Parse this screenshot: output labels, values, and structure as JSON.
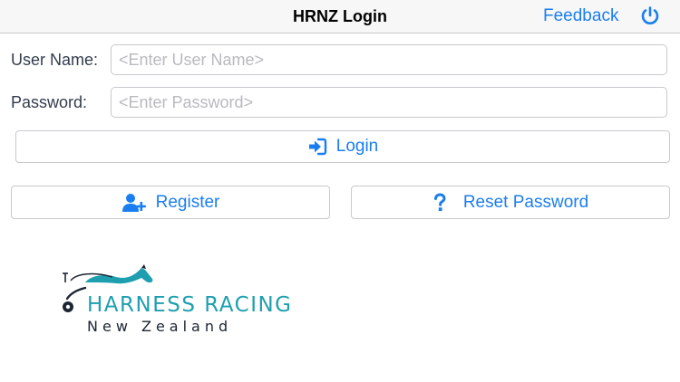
{
  "navbar": {
    "title": "HRNZ Login",
    "feedback_label": "Feedback",
    "power_icon": "power-icon"
  },
  "form": {
    "username": {
      "label": "User Name:",
      "placeholder": "<Enter User Name>",
      "value": ""
    },
    "password": {
      "label": "Password:",
      "placeholder": "<Enter Password>",
      "value": ""
    }
  },
  "buttons": {
    "login_label": "Login",
    "login_icon": "sign-in-icon",
    "register_label": "Register",
    "register_icon": "user-plus-icon",
    "reset_label": "Reset Password",
    "reset_icon": "question-icon"
  },
  "logo": {
    "line1": "HARNESS RACING",
    "line2": "New Zealand"
  },
  "colors": {
    "accent": "#1a7ef0",
    "logo_teal": "#1e9fb0",
    "logo_dark": "#1c2433"
  }
}
